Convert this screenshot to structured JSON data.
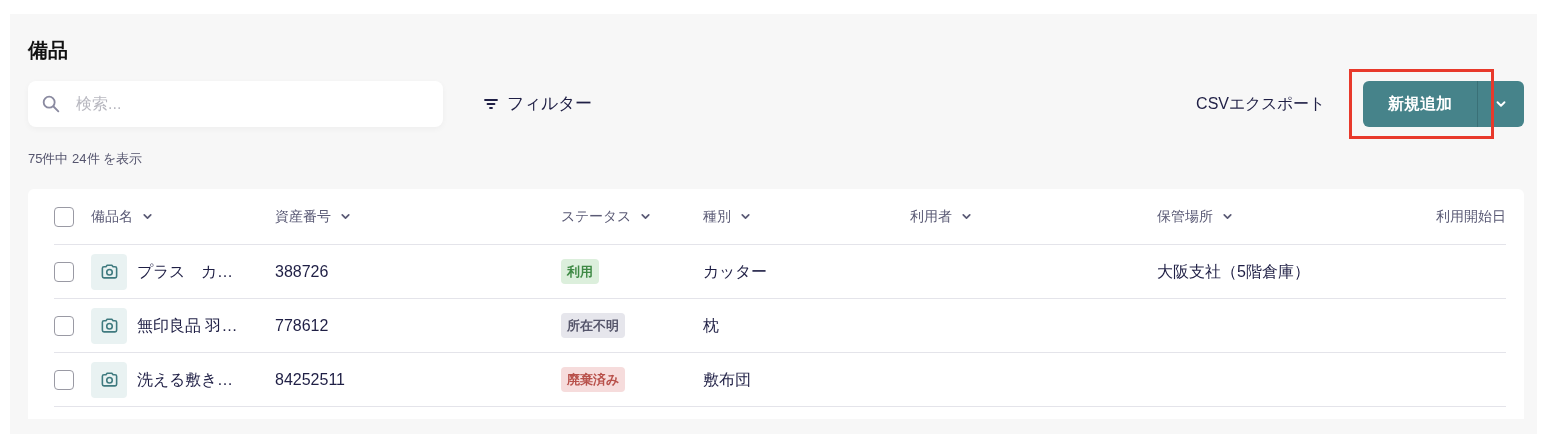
{
  "title": "備品",
  "search": {
    "placeholder": "検索..."
  },
  "filter_button": "フィルター",
  "export_button": "CSVエクスポート",
  "add_button": {
    "label": "新規追加",
    "highlighted": true
  },
  "result_count": "75件中 24件 を表示",
  "table": {
    "select_all": {
      "checked": false
    },
    "columns": [
      {
        "label": "備品名",
        "sortable": true
      },
      {
        "label": "資産番号",
        "sortable": true
      },
      {
        "label": "ステータス",
        "sortable": true
      },
      {
        "label": "種別",
        "sortable": true
      },
      {
        "label": "利用者",
        "sortable": true
      },
      {
        "label": "保管場所",
        "sortable": true
      },
      {
        "label": "利用開始日",
        "sortable": false
      }
    ],
    "rows": [
      {
        "checked": false,
        "name": "プラス　カ…",
        "asset_number": "388726",
        "status": {
          "label": "利用",
          "kind": "in_use"
        },
        "type": "カッター",
        "location": "大阪支社（5階倉庫）"
      },
      {
        "checked": false,
        "name": "無印良品 羽…",
        "asset_number": "778612",
        "status": {
          "label": "所在不明",
          "kind": "missing"
        },
        "type": "枕"
      },
      {
        "checked": false,
        "name": "洗える敷き…",
        "asset_number": "84252511",
        "status": {
          "label": "廃棄済み",
          "kind": "disposed"
        },
        "type": "敷布団"
      }
    ]
  }
}
